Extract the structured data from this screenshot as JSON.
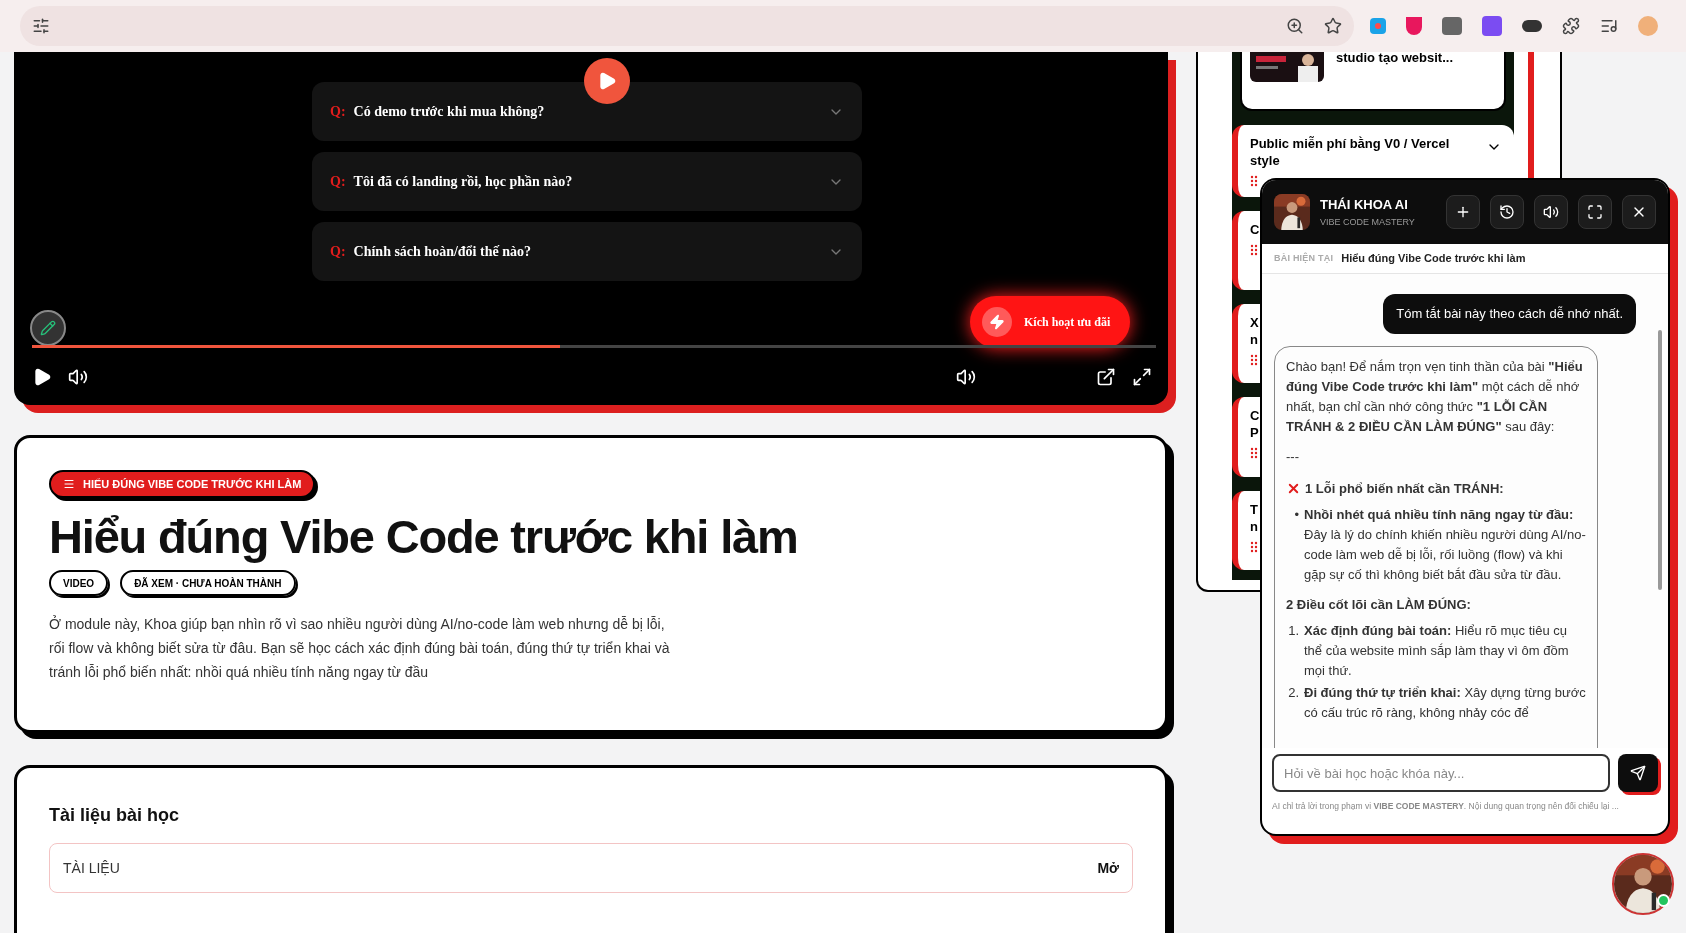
{
  "video": {
    "faq": [
      {
        "marker": "Q:",
        "question": "Có demo trước khi mua không?",
        "expanded": false
      },
      {
        "marker": "Q:",
        "question": "Tôi đã có landing rồi, học phần nào?",
        "expanded": false
      },
      {
        "marker": "Q:",
        "question": "Chính sách hoàn/đổi thế nào?",
        "expanded": false
      }
    ],
    "cta": "Kích hoạt ưu đãi",
    "progress": {
      "level": 0.47
    }
  },
  "lesson": {
    "tag": "HIỂU ĐÚNG VIBE CODE TRƯỚC KHI LÀM",
    "title": "Hiểu đúng Vibe Code trước khi làm",
    "badges": [
      "VIDEO",
      "ĐÃ XEM · CHƯA HOÀN THÀNH"
    ],
    "description": "Ở module này, Khoa giúp bạn nhìn rõ vì sao nhiều người dùng AI/no-code làm web nhưng dễ bị lỗi, rối flow và không biết sửa từ đâu. Bạn sẽ học cách xác định đúng bài toán, đúng thứ tự triển khai và tránh lỗi phổ biến nhất: nhồi quá nhiều tính năng ngay từ đầu"
  },
  "materials": {
    "heading": "Tài liệu bài học",
    "items": [
      {
        "label": "TÀI LIỆU",
        "action": "Mở"
      }
    ]
  },
  "sidebar": {
    "cards": [
      {
        "kind": "thumb",
        "lines": [
          "studio tạo websit..."
        ]
      },
      {
        "kind": "section",
        "lines": [
          "Public miễn phí bằng V0 / Vercel",
          "style"
        ],
        "expanded": false
      },
      {
        "kind": "partial",
        "lines": [
          "C"
        ]
      },
      {
        "kind": "partial",
        "lines": [
          "X",
          "n"
        ]
      },
      {
        "kind": "partial",
        "lines": [
          "C",
          "P"
        ]
      },
      {
        "kind": "partial",
        "lines": [
          "T",
          "n"
        ]
      }
    ]
  },
  "chat": {
    "title": "THÁI KHOA AI",
    "subtitle": "VIBE CODE MASTERY",
    "context_label": "BÀI HIỆN TẠI",
    "context_value": "Hiểu đúng Vibe Code trước khi làm",
    "messages": [
      {
        "kind": "user",
        "text": "Tóm tắt bài này theo cách dễ nhớ nhất."
      },
      {
        "kind": "assistant",
        "blocks": [
          {
            "kind": "paragraph",
            "text": "Chào bạn! Để nắm trọn vẹn tinh thần của bài **\"Hiểu đúng Vibe Code trước khi làm\"** một cách dễ nhớ nhất, bạn chỉ cần nhớ công thức **\"1 LỖI CẦN TRÁNH & 2 ĐIỀU CẦN LÀM ĐÚNG\"** sau đây:"
          },
          {
            "kind": "rule",
            "text": "---"
          },
          {
            "kind": "alert_heading",
            "text": "1 Lỗi phổ biến nhất cần TRÁNH:"
          },
          {
            "kind": "list",
            "items": [
              {
                "marker": "•",
                "text": "**Nhồi nhét quá nhiều tính năng ngay từ đầu:** Đây là lý do chính khiến nhiều người dùng AI/no-code làm web dễ bị lỗi, rối luồng (flow) và khi gặp sự cố thì không biết bắt đầu sửa từ đầu."
              }
            ]
          },
          {
            "kind": "heading",
            "text": "2 Điều cốt lõi cần LÀM ĐÚNG:"
          },
          {
            "kind": "list",
            "items": [
              {
                "marker": "1.",
                "text": "**Xác định đúng bài toán:** Hiểu rõ mục tiêu cụ thể của website mình sắp làm thay vì ôm đồm mọi thứ."
              },
              {
                "marker": "2.",
                "text": "**Đi đúng thứ tự triển khai:** Xây dựng từng bước có cấu trúc rõ ràng, không nhảy cóc để"
              }
            ]
          }
        ]
      }
    ],
    "input": {
      "placeholder": "Hỏi về bài học hoặc khóa này..."
    },
    "footer": "AI chỉ trả lời trong phạm vi **VIBE CODE MASTERY**. Nội dung quan trọng nên đối chiếu lại ...",
    "launcher": {
      "online": true
    }
  }
}
